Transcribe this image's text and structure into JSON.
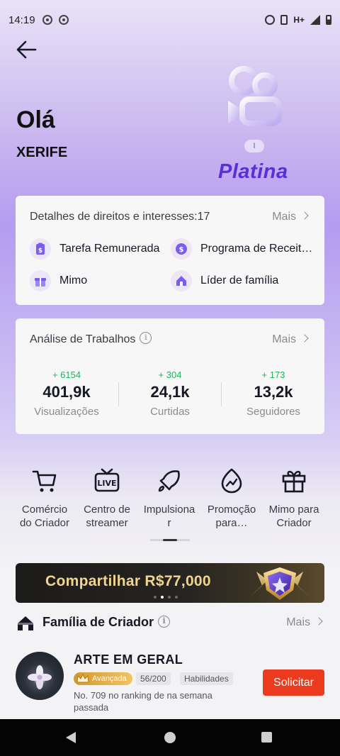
{
  "status_bar": {
    "time": "14:19",
    "network": "H+"
  },
  "profile": {
    "greeting": "Olá",
    "username": "XERIFE"
  },
  "tier": {
    "level": "I",
    "name": "Platina"
  },
  "rights": {
    "title": "Detalhes de direitos e interesses:17",
    "more": "Mais",
    "items": [
      {
        "label": "Tarefa Remunerada",
        "icon": "task-badge-icon"
      },
      {
        "label": "Programa de Receit…",
        "icon": "dollar-coin-icon"
      },
      {
        "label": "Mimo",
        "icon": "gift-icon"
      },
      {
        "label": "Líder de família",
        "icon": "family-tent-icon"
      }
    ]
  },
  "works": {
    "title": "Análise de Trabalhos",
    "info": "i",
    "more": "Mais",
    "stats": [
      {
        "delta": "+ 6154",
        "value": "401,9k",
        "label": "Visualizações"
      },
      {
        "delta": "+ 304",
        "value": "24,1k",
        "label": "Curtidas"
      },
      {
        "delta": "+ 173",
        "value": "13,2k",
        "label": "Seguidores"
      }
    ]
  },
  "tools": [
    {
      "label1": "Comércio",
      "label2": "do Criador",
      "icon": "shopping-cart-icon"
    },
    {
      "label1": "Centro de",
      "label2": "streamer",
      "icon": "live-tv-icon"
    },
    {
      "label1": "Impulsiona",
      "label2": "r",
      "icon": "rocket-icon"
    },
    {
      "label1": "Promoção",
      "label2": "para…",
      "icon": "promotion-flame-icon"
    },
    {
      "label1": "Mimo para",
      "label2": "Criador",
      "icon": "gift-box-icon"
    }
  ],
  "banner": {
    "text": "Compartilhar R$77,000"
  },
  "family": {
    "title": "Família de Criador",
    "info": "i",
    "more": "Mais",
    "name": "ARTE EM GERAL",
    "level_badge": "Avançada",
    "member_count": "56/200",
    "skill_badge": "Habilidades",
    "rank_text": "No. 709 no ranking de na semana passada",
    "apply_label": "Solicitar"
  },
  "colors": {
    "accent": "#ec3a1e",
    "tier": "#5b2fd6",
    "positive": "#22b45a"
  }
}
